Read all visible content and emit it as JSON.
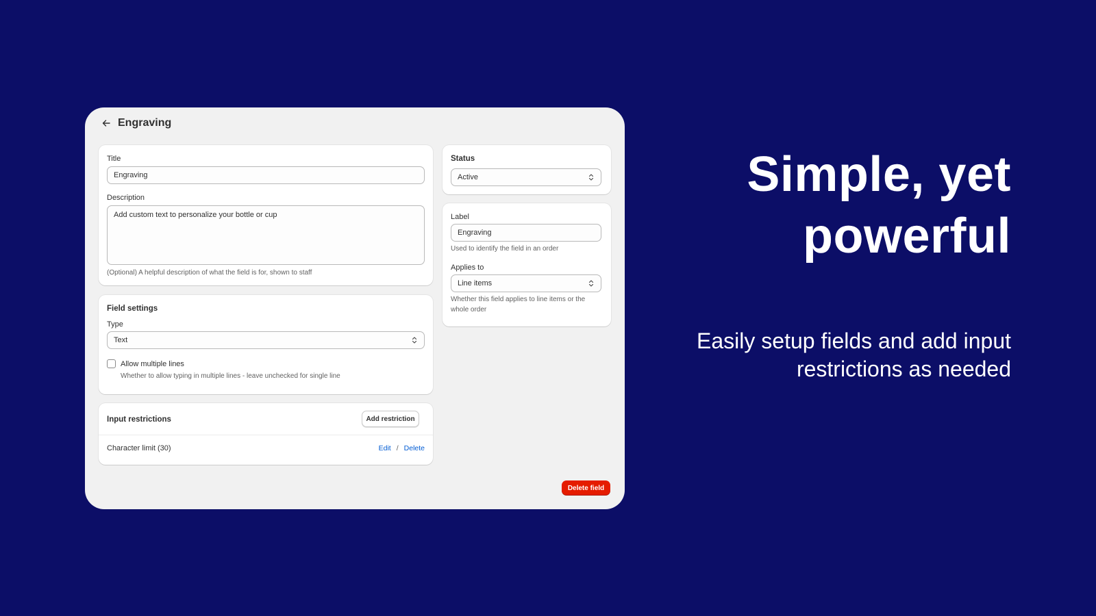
{
  "page": {
    "title": "Engraving",
    "background_color": "#0c0e67"
  },
  "details": {
    "title_label": "Title",
    "title_value": "Engraving",
    "description_label": "Description",
    "description_value": "Add custom text to personalize your bottle or cup",
    "description_help": "(Optional) A helpful description of what the field is for, shown to staff"
  },
  "field_settings": {
    "heading": "Field settings",
    "type_label": "Type",
    "type_value": "Text",
    "multiline_label": "Allow multiple lines",
    "multiline_checked": false,
    "multiline_help": "Whether to allow typing in multiple lines - leave unchecked for single line"
  },
  "restrictions": {
    "heading": "Input restrictions",
    "add_button": "Add restriction",
    "items": [
      {
        "label": "Character limit (30)",
        "edit": "Edit",
        "separator": "/",
        "delete": "Delete"
      }
    ]
  },
  "status": {
    "heading": "Status",
    "value": "Active"
  },
  "label_card": {
    "label": "Label",
    "value": "Engraving",
    "help": "Used to identify the field in an order",
    "applies_label": "Applies to",
    "applies_value": "Line items",
    "applies_help": "Whether this field applies to line items or the whole order"
  },
  "actions": {
    "delete_field": "Delete field",
    "danger_color": "#e51c00",
    "link_color": "#005bd3"
  },
  "marketing": {
    "headline": "Simple, yet powerful",
    "subline": "Easily setup fields and add input restrictions as needed"
  },
  "icons": {
    "back": "arrow-left-icon",
    "select": "chevron-up-down-icon"
  }
}
